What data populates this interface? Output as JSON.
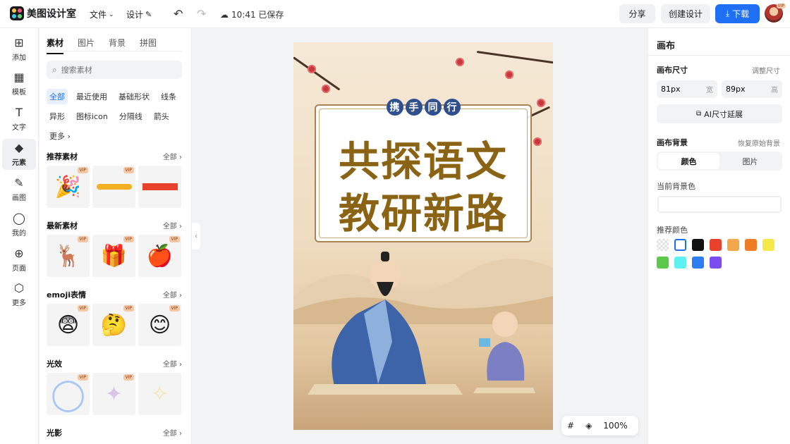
{
  "app": {
    "name": "美图设计室"
  },
  "topbar": {
    "file_menu": "文件",
    "design_menu": "设计",
    "save_status": "10:41 已保存",
    "share_label": "分享",
    "create_label": "创建设计",
    "download_label": "下载",
    "avatar_badge": "VIP"
  },
  "rail": [
    {
      "label": "添加",
      "icon": "plus-square-icon",
      "glyph": "⊞"
    },
    {
      "label": "模板",
      "icon": "template-icon",
      "glyph": "▦"
    },
    {
      "label": "文字",
      "icon": "text-icon",
      "glyph": "T"
    },
    {
      "label": "元素",
      "icon": "shapes-icon",
      "glyph": "◆"
    },
    {
      "label": "画图",
      "icon": "draw-icon",
      "glyph": "✎"
    },
    {
      "label": "我的",
      "icon": "user-icon",
      "glyph": "◯"
    },
    {
      "label": "页面",
      "icon": "page-icon",
      "glyph": "⊕"
    },
    {
      "label": "更多",
      "icon": "cube-icon",
      "glyph": "⬡"
    }
  ],
  "panel": {
    "tabs": [
      "素材",
      "图片",
      "背景",
      "拼图"
    ],
    "search_placeholder": "搜索素材",
    "chips": [
      "全部",
      "最近使用",
      "基础形状",
      "线条",
      "异形",
      "图标icon",
      "分隔线",
      "箭头",
      "更多 ›"
    ],
    "vip_label": "VIP",
    "all_label": "全部 ›",
    "sections": [
      {
        "title": "推荐素材",
        "thumbs": [
          "🎉",
          "▬",
          "▬"
        ]
      },
      {
        "title": "最新素材",
        "thumbs": [
          "🦌",
          "🎁",
          "🍎"
        ]
      },
      {
        "title": "emoji表情",
        "thumbs": [
          "😨",
          "🤔",
          "😊"
        ]
      },
      {
        "title": "光效",
        "thumbs": [
          "◯",
          "✦",
          "✧"
        ]
      },
      {
        "title": "光影",
        "thumbs": []
      }
    ]
  },
  "poster": {
    "badge_chars": [
      "携",
      "手",
      "同",
      "行"
    ],
    "title_line1": "共探语文",
    "title_line2": "教研新路"
  },
  "zoom": {
    "grid_icon": "#",
    "layers_icon": "◈",
    "level": "100%"
  },
  "right": {
    "title": "画布",
    "size_label": "画布尺寸",
    "adjust_label": "调整尺寸",
    "width_value": "81px",
    "width_unit": "宽",
    "height_value": "89px",
    "height_unit": "高",
    "ai_extend": "AI尺寸延展",
    "bg_label": "画布背景",
    "restore_label": "恢复原始背景",
    "seg_color": "颜色",
    "seg_image": "图片",
    "current_bg_label": "当前背景色",
    "recommend_label": "推荐颜色",
    "swatches": [
      "transparent",
      "#ffffff",
      "#111111",
      "#e8412c",
      "#f3a64a",
      "#f07b27",
      "#f7e84a",
      "#5bc94b",
      "#5ff0f0",
      "#2d7ef2",
      "#7b4cf0"
    ]
  }
}
